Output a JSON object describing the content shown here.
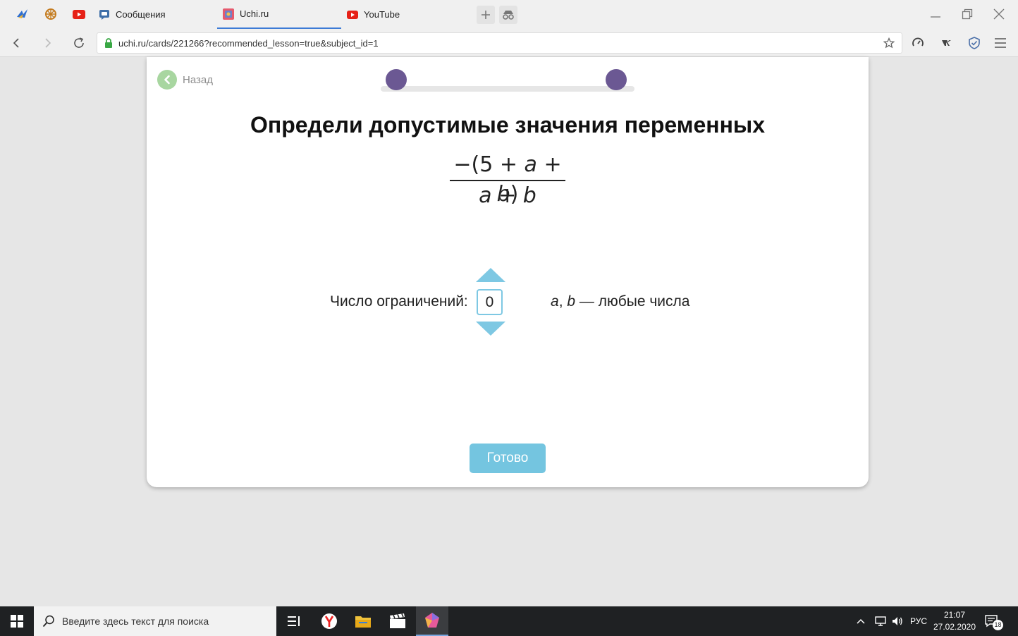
{
  "browser": {
    "tabs": [
      {
        "label": "Сообщения"
      },
      {
        "label": "Uchi.ru"
      },
      {
        "label": "YouTube"
      }
    ],
    "url": "uchi.ru/cards/221266?recommended_lesson=true&subject_id=1"
  },
  "lesson": {
    "back_label": "Назад",
    "title": "Определи допустимые значения переменных",
    "numerator": {
      "pre": "−(5 + ",
      "a": "a",
      "mid": " + ",
      "b": "b",
      "post": ")"
    },
    "denominator": {
      "a": "a",
      "mid": " + ",
      "b": "b"
    },
    "limits_label": "Число ограничений:",
    "limits_value": "0",
    "answer": {
      "a": "a",
      "comma": ", ",
      "b": "b",
      "rest": " — любые числа"
    },
    "done_label": "Готово",
    "colors": {
      "accent": "#74c5e0",
      "progress_dot": "#6b5893",
      "back": "#a8d6a0"
    }
  },
  "taskbar": {
    "search_placeholder": "Введите здесь текст для поиска",
    "lang": "РУС",
    "time": "21:07",
    "date": "27.02.2020",
    "notifications": "18"
  }
}
